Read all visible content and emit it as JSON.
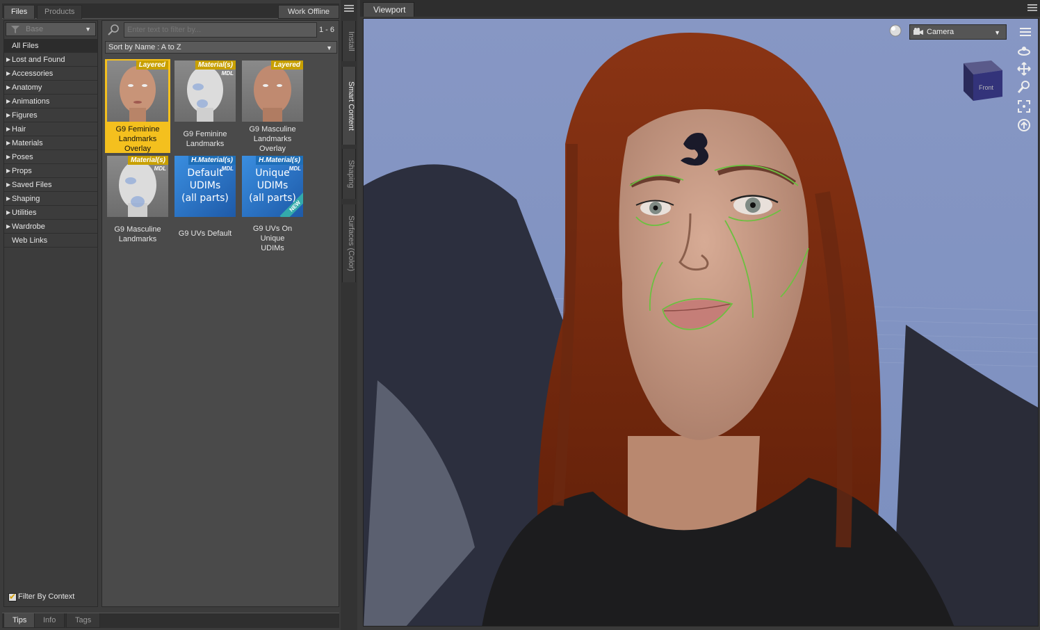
{
  "top_tabs": {
    "files": "Files",
    "products": "Products",
    "work_offline": "Work Offline"
  },
  "nav": {
    "base_dropdown": "Base",
    "items": [
      {
        "label": "All Files",
        "expandable": false
      },
      {
        "label": "Lost and Found",
        "expandable": true
      },
      {
        "label": "Accessories",
        "expandable": true
      },
      {
        "label": "Anatomy",
        "expandable": true
      },
      {
        "label": "Animations",
        "expandable": true
      },
      {
        "label": "Figures",
        "expandable": true
      },
      {
        "label": "Hair",
        "expandable": true
      },
      {
        "label": "Materials",
        "expandable": true
      },
      {
        "label": "Poses",
        "expandable": true
      },
      {
        "label": "Props",
        "expandable": true
      },
      {
        "label": "Saved Files",
        "expandable": true
      },
      {
        "label": "Shaping",
        "expandable": true
      },
      {
        "label": "Utilities",
        "expandable": true
      },
      {
        "label": "Wardrobe",
        "expandable": true
      },
      {
        "label": "Web Links",
        "expandable": false
      }
    ],
    "filter_by_context": "Filter By Context"
  },
  "search": {
    "placeholder": "Enter text to filter by...",
    "count": "1 - 6"
  },
  "sort": {
    "label": "Sort by Name : A to Z"
  },
  "tiles": [
    {
      "name": "G9 Feminine Landmarks Overlay",
      "line1": "G9 Feminine",
      "line2": "Landmarks",
      "line3": "Overlay",
      "badge": "Layered",
      "mdl": ""
    },
    {
      "name": "G9 Feminine Landmarks",
      "line1": "G9 Feminine",
      "line2": "Landmarks",
      "line3": "",
      "badge": "Material(s)",
      "mdl": "MDL"
    },
    {
      "name": "G9 Masculine Landmarks Overlay",
      "line1": "G9 Masculine",
      "line2": "Landmarks",
      "line3": "Overlay",
      "badge": "Layered",
      "mdl": ""
    },
    {
      "name": "G9 Masculine Landmarks",
      "line1": "G9 Masculine",
      "line2": "Landmarks",
      "line3": "",
      "badge": "Material(s)",
      "mdl": "MDL"
    },
    {
      "name": "G9 UVs Default",
      "line1": "G9 UVs Default",
      "line2": "",
      "line3": "",
      "badge": "H.Material(s)",
      "mdl": "MDL",
      "thumb_text": [
        "Default",
        "UDIMs",
        "(all parts)"
      ]
    },
    {
      "name": "G9 UVs On Unique UDIMs",
      "line1": "G9 UVs On Unique",
      "line2": "UDIMs",
      "line3": "",
      "badge": "H.Material(s)",
      "mdl": "MDL",
      "thumb_text": [
        "Unique",
        "UDIMs",
        "(all parts)"
      ],
      "ribbon": "NEW"
    }
  ],
  "side_tabs": {
    "install": "Install",
    "smart_content": "Smart Content",
    "shaping": "Shaping",
    "surfaces": "Surfaces (Color)"
  },
  "bottom_tabs": {
    "tips": "Tips",
    "info": "Info",
    "tags": "Tags"
  },
  "viewport": {
    "tab": "Viewport",
    "camera": "Camera",
    "cube_face": "Front"
  },
  "colors": {
    "selected_tile": "#f4c01e",
    "viewport_bg": "#8a9bc5",
    "hair": "#7a2810",
    "landmark_lines": "#6cc040"
  },
  "icons": [
    "filter-icon",
    "search-icon",
    "menu-icon",
    "camera-icon",
    "orbit-icon",
    "pan-icon",
    "zoom-icon",
    "frame-icon",
    "home-icon",
    "view-cube-icon"
  ]
}
